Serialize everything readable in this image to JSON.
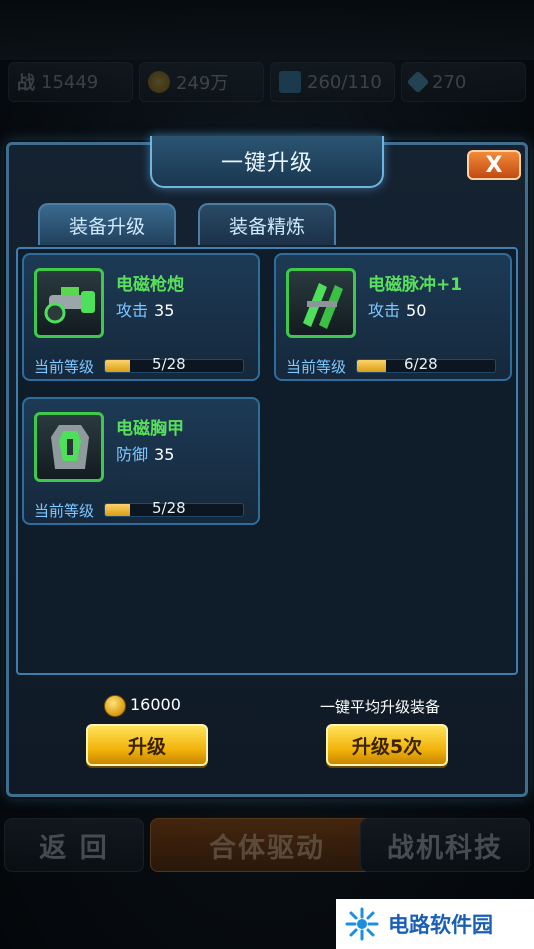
{
  "stats": {
    "power_label": "战",
    "power": "15449",
    "gold": "249万",
    "energy": "260/110",
    "diamonds": "270"
  },
  "dialog": {
    "title": "一键升级",
    "close_label": "X",
    "tabs": [
      {
        "label": "装备升级",
        "active": true
      },
      {
        "label": "装备精炼",
        "active": false
      }
    ],
    "items": [
      {
        "name": "电磁枪炮",
        "stat_label": "攻击",
        "stat_value": "35",
        "level_label": "当前等级",
        "level_text": "5/28",
        "level_fraction": 0.18
      },
      {
        "name": "电磁脉冲+1",
        "stat_label": "攻击",
        "stat_value": "50",
        "level_label": "当前等级",
        "level_text": "6/28",
        "level_fraction": 0.21
      },
      {
        "name": "电磁胸甲",
        "stat_label": "防御",
        "stat_value": "35",
        "level_label": "当前等级",
        "level_text": "5/28",
        "level_fraction": 0.18
      }
    ],
    "cost": "16000",
    "hint": "一键平均升级装备",
    "upgrade_button": "升级",
    "upgrade5_button": "升级5次"
  },
  "bottom_nav": {
    "back": "返 回",
    "merge": "合体驱动",
    "tech": "战机科技"
  },
  "watermark": {
    "text": "电路软件园"
  },
  "colors": {
    "accent_green": "#59e05a",
    "gold_button": "#f2b40c",
    "frame_blue": "#3d7fb0",
    "close_orange": "#e0661c"
  }
}
